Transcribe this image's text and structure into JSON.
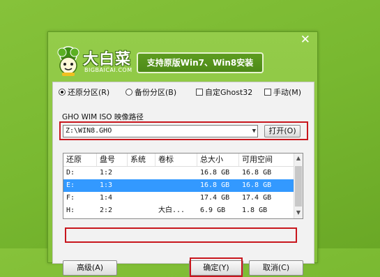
{
  "logo": {
    "brand": "大白菜",
    "brand_sub": "BIGBAICAI.COM"
  },
  "banner": "支持原版Win7、Win8安装",
  "options": {
    "restore": "还原分区(R)",
    "backup": "备份分区(B)",
    "ghost32": "自定Ghost32",
    "manual": "手动(M)",
    "selected": "restore"
  },
  "path": {
    "label": "GHO WIM ISO 映像路径",
    "value": "Z:\\WIN8.GHO",
    "open_button": "打开(O)"
  },
  "table": {
    "headers": [
      "还原",
      "盘号",
      "系统",
      "卷标",
      "总大小",
      "可用空间"
    ],
    "rows": [
      {
        "drive": "D:",
        "disk": "1:2",
        "system": "",
        "label": "",
        "total": "16.8 GB",
        "free": "16.8 GB"
      },
      {
        "drive": "E:",
        "disk": "1:3",
        "system": "",
        "label": "",
        "total": "16.8 GB",
        "free": "16.8 GB"
      },
      {
        "drive": "F:",
        "disk": "1:4",
        "system": "",
        "label": "",
        "total": "17.4 GB",
        "free": "17.4 GB"
      },
      {
        "drive": "H:",
        "disk": "2:2",
        "system": "",
        "label": "大白...",
        "total": "6.9 GB",
        "free": "1.8 GB"
      }
    ],
    "selected_row": 1
  },
  "buttons": {
    "advanced": "高级(A)",
    "ok": "确定(Y)",
    "cancel": "取消(C)"
  },
  "colors": {
    "selection": "#3399ff",
    "highlight_red": "#c8161d",
    "green_bg": "#7fbd35"
  }
}
